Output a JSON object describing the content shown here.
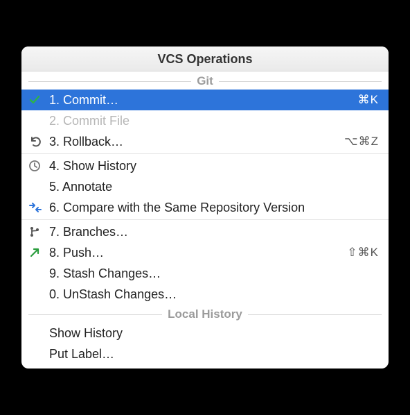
{
  "title": "VCS Operations",
  "sections": {
    "git": {
      "label": "Git",
      "groups": [
        [
          {
            "icon": "check-icon",
            "label": "1. Commit…",
            "shortcut": "⌘K",
            "selected": true
          },
          {
            "icon": "",
            "label": "2. Commit File",
            "disabled": true
          },
          {
            "icon": "undo-icon",
            "label": "3. Rollback…",
            "shortcut": "⌥⌘Z"
          }
        ],
        [
          {
            "icon": "clock-icon",
            "label": "4. Show History"
          },
          {
            "icon": "",
            "label": "5. Annotate"
          },
          {
            "icon": "compare-icon",
            "label": "6. Compare with the Same Repository Version"
          }
        ],
        [
          {
            "icon": "branch-icon",
            "label": "7. Branches…"
          },
          {
            "icon": "push-icon",
            "label": "8. Push…",
            "shortcut": "⇧⌘K"
          },
          {
            "icon": "",
            "label": "9. Stash Changes…"
          },
          {
            "icon": "",
            "label": "0. UnStash Changes…"
          }
        ]
      ]
    },
    "local_history": {
      "label": "Local History",
      "items": [
        {
          "label": "Show History"
        },
        {
          "label": "Put Label…"
        }
      ]
    }
  }
}
